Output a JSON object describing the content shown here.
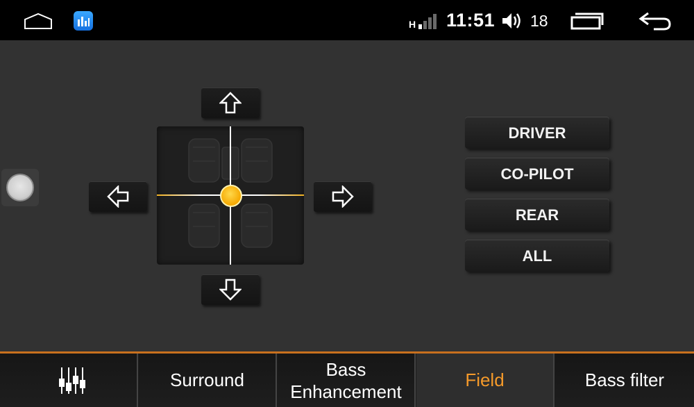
{
  "status_bar": {
    "icons": {
      "home": "home-icon",
      "app": "music-app-icon",
      "signal": "signal-strength-icon",
      "volume": "volume-icon",
      "recents": "recent-apps-icon",
      "back": "back-icon"
    },
    "network_label": "H",
    "time": "11:51",
    "volume_level": "18"
  },
  "field_panel": {
    "arrows": {
      "up": "arrow-up-icon",
      "down": "arrow-down-icon",
      "left": "arrow-left-icon",
      "right": "arrow-right-icon"
    },
    "zone_buttons": [
      "DRIVER",
      "CO-PILOT",
      "REAR",
      "ALL"
    ]
  },
  "tabs": [
    {
      "label": "",
      "icon": "equalizer-icon"
    },
    {
      "label": "Surround"
    },
    {
      "label_line1": "Bass",
      "label_line2": "Enhancement"
    },
    {
      "label": "Field",
      "active": true
    },
    {
      "label": "Bass filter"
    }
  ],
  "colors": {
    "accent": "#f59a2a",
    "divider": "#c8701e",
    "position_dot": "#f5a800"
  }
}
